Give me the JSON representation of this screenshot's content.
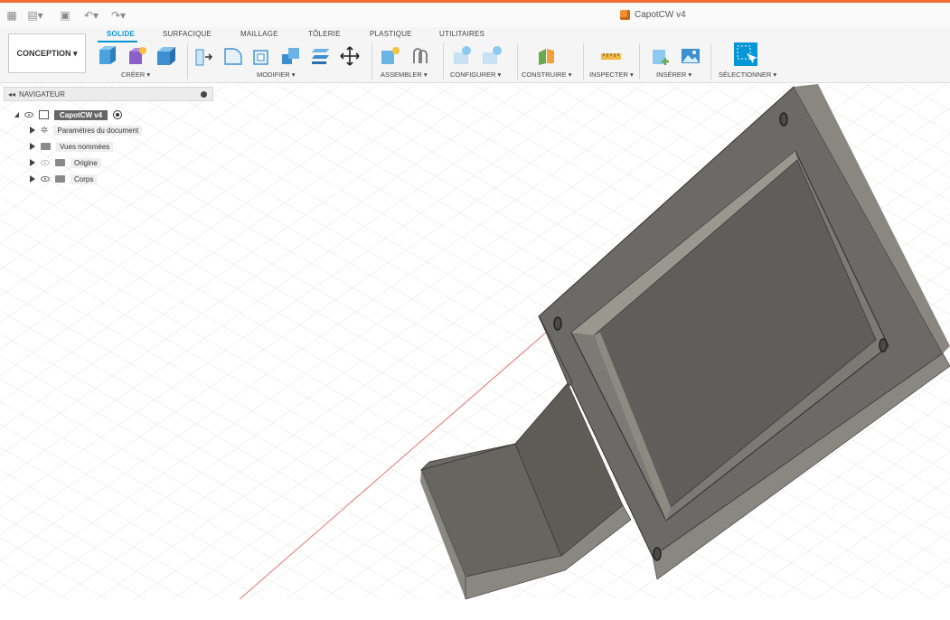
{
  "window": {
    "title": "CapotCW v4"
  },
  "workspace": {
    "label": "CONCEPTION ▾"
  },
  "tabs": [
    "SOLIDE",
    "SURFACIQUE",
    "MAILLAGE",
    "TÔLERIE",
    "PLASTIQUE",
    "UTILITAIRES"
  ],
  "groups": [
    "CRÉER ▾",
    "MODIFIER ▾",
    "ASSEMBLER ▾",
    "CONFIGURER ▾",
    "CONSTRUIRE ▾",
    "INSPECTER ▾",
    "INSÉRER ▾",
    "SÉLECTIONNER ▾"
  ],
  "navigator": {
    "title": "NAVIGATEUR",
    "root": "CapotCW v4",
    "items": [
      "Paramètres du document",
      "Vues nommées",
      "Origine",
      "Corps"
    ]
  },
  "colors": {
    "accent": "#0696d7",
    "brand": "#ef6c35",
    "model": "#6b6a66"
  }
}
